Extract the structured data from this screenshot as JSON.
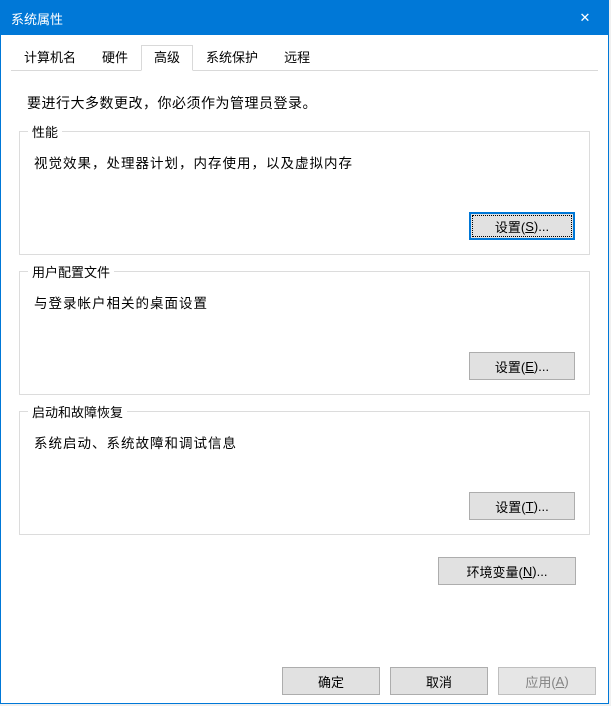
{
  "window": {
    "title": "系统属性",
    "close_glyph": "✕"
  },
  "tabs": {
    "computer_name": "计算机名",
    "hardware": "硬件",
    "advanced": "高级",
    "system_protection": "系统保护",
    "remote": "远程"
  },
  "content": {
    "info": "要进行大多数更改，你必须作为管理员登录。",
    "performance": {
      "legend": "性能",
      "desc": "视觉效果，处理器计划，内存使用，以及虚拟内存",
      "btn_prefix": "设置(",
      "btn_mn": "S",
      "btn_suffix": ")..."
    },
    "user_profiles": {
      "legend": "用户配置文件",
      "desc": "与登录帐户相关的桌面设置",
      "btn_prefix": "设置(",
      "btn_mn": "E",
      "btn_suffix": ")..."
    },
    "startup_recovery": {
      "legend": "启动和故障恢复",
      "desc": "系统启动、系统故障和调试信息",
      "btn_prefix": "设置(",
      "btn_mn": "T",
      "btn_suffix": ")..."
    },
    "envvars": {
      "btn_prefix": "环境变量(",
      "btn_mn": "N",
      "btn_suffix": ")..."
    }
  },
  "footer": {
    "ok": "确定",
    "cancel": "取消",
    "apply_prefix": "应用(",
    "apply_mn": "A",
    "apply_suffix": ")"
  }
}
